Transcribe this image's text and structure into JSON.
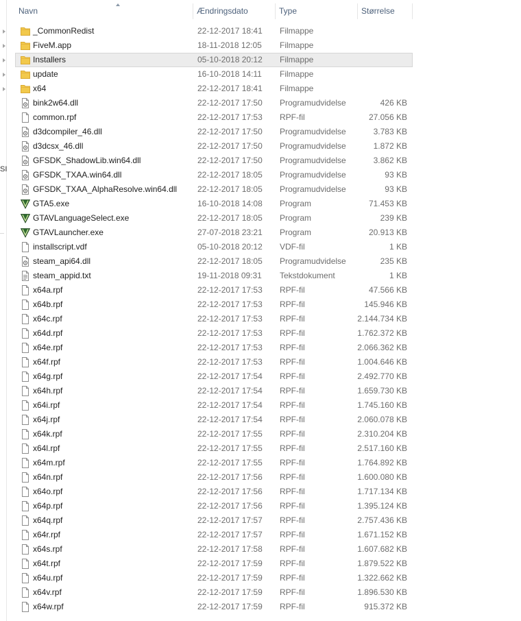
{
  "columns": {
    "name": "Navn",
    "date": "Ændringsdato",
    "type": "Type",
    "size": "Størrelse"
  },
  "left_pane": {
    "partial_text": "SI"
  },
  "colors": {
    "header_text": "#4c607a",
    "folder": "#f2c94c",
    "selected_row": "#ececec"
  },
  "files": [
    {
      "name": "_CommonRedist",
      "date": "22-12-2017 18:41",
      "type": "Filmappe",
      "size": "",
      "icon": "folder-icon",
      "selected": false
    },
    {
      "name": "FiveM.app",
      "date": "18-11-2018 12:05",
      "type": "Filmappe",
      "size": "",
      "icon": "folder-icon",
      "selected": false
    },
    {
      "name": "Installers",
      "date": "05-10-2018 20:12",
      "type": "Filmappe",
      "size": "",
      "icon": "folder-icon",
      "selected": true
    },
    {
      "name": "update",
      "date": "16-10-2018 14:11",
      "type": "Filmappe",
      "size": "",
      "icon": "folder-icon",
      "selected": false
    },
    {
      "name": "x64",
      "date": "22-12-2017 18:41",
      "type": "Filmappe",
      "size": "",
      "icon": "folder-icon",
      "selected": false
    },
    {
      "name": "bink2w64.dll",
      "date": "22-12-2017 17:50",
      "type": "Programudvidelse",
      "size": "426 KB",
      "icon": "dll-icon",
      "selected": false
    },
    {
      "name": "common.rpf",
      "date": "22-12-2017 17:53",
      "type": "RPF-fil",
      "size": "27.056 KB",
      "icon": "file-icon",
      "selected": false
    },
    {
      "name": "d3dcompiler_46.dll",
      "date": "22-12-2017 17:50",
      "type": "Programudvidelse",
      "size": "3.783 KB",
      "icon": "dll-icon",
      "selected": false
    },
    {
      "name": "d3dcsx_46.dll",
      "date": "22-12-2017 17:50",
      "type": "Programudvidelse",
      "size": "1.872 KB",
      "icon": "dll-icon",
      "selected": false
    },
    {
      "name": "GFSDK_ShadowLib.win64.dll",
      "date": "22-12-2017 17:50",
      "type": "Programudvidelse",
      "size": "3.862 KB",
      "icon": "dll-icon",
      "selected": false
    },
    {
      "name": "GFSDK_TXAA.win64.dll",
      "date": "22-12-2017 18:05",
      "type": "Programudvidelse",
      "size": "93 KB",
      "icon": "dll-icon",
      "selected": false
    },
    {
      "name": "GFSDK_TXAA_AlphaResolve.win64.dll",
      "date": "22-12-2017 18:05",
      "type": "Programudvidelse",
      "size": "93 KB",
      "icon": "dll-icon",
      "selected": false
    },
    {
      "name": "GTA5.exe",
      "date": "16-10-2018 14:08",
      "type": "Program",
      "size": "71.453 KB",
      "icon": "gta-v-icon",
      "selected": false
    },
    {
      "name": "GTAVLanguageSelect.exe",
      "date": "22-12-2017 18:05",
      "type": "Program",
      "size": "239 KB",
      "icon": "gta-v-icon",
      "selected": false
    },
    {
      "name": "GTAVLauncher.exe",
      "date": "27-07-2018 23:21",
      "type": "Program",
      "size": "20.913 KB",
      "icon": "gta-v-icon",
      "selected": false
    },
    {
      "name": "installscript.vdf",
      "date": "05-10-2018 20:12",
      "type": "VDF-fil",
      "size": "1 KB",
      "icon": "file-icon",
      "selected": false
    },
    {
      "name": "steam_api64.dll",
      "date": "22-12-2017 18:05",
      "type": "Programudvidelse",
      "size": "235 KB",
      "icon": "dll-icon",
      "selected": false
    },
    {
      "name": "steam_appid.txt",
      "date": "19-11-2018 09:31",
      "type": "Tekstdokument",
      "size": "1 KB",
      "icon": "text-file-icon",
      "selected": false
    },
    {
      "name": "x64a.rpf",
      "date": "22-12-2017 17:53",
      "type": "RPF-fil",
      "size": "47.566 KB",
      "icon": "file-icon",
      "selected": false
    },
    {
      "name": "x64b.rpf",
      "date": "22-12-2017 17:53",
      "type": "RPF-fil",
      "size": "145.946 KB",
      "icon": "file-icon",
      "selected": false
    },
    {
      "name": "x64c.rpf",
      "date": "22-12-2017 17:53",
      "type": "RPF-fil",
      "size": "2.144.734 KB",
      "icon": "file-icon",
      "selected": false
    },
    {
      "name": "x64d.rpf",
      "date": "22-12-2017 17:53",
      "type": "RPF-fil",
      "size": "1.762.372 KB",
      "icon": "file-icon",
      "selected": false
    },
    {
      "name": "x64e.rpf",
      "date": "22-12-2017 17:53",
      "type": "RPF-fil",
      "size": "2.066.362 KB",
      "icon": "file-icon",
      "selected": false
    },
    {
      "name": "x64f.rpf",
      "date": "22-12-2017 17:53",
      "type": "RPF-fil",
      "size": "1.004.646 KB",
      "icon": "file-icon",
      "selected": false
    },
    {
      "name": "x64g.rpf",
      "date": "22-12-2017 17:54",
      "type": "RPF-fil",
      "size": "2.492.770 KB",
      "icon": "file-icon",
      "selected": false
    },
    {
      "name": "x64h.rpf",
      "date": "22-12-2017 17:54",
      "type": "RPF-fil",
      "size": "1.659.730 KB",
      "icon": "file-icon",
      "selected": false
    },
    {
      "name": "x64i.rpf",
      "date": "22-12-2017 17:54",
      "type": "RPF-fil",
      "size": "1.745.160 KB",
      "icon": "file-icon",
      "selected": false
    },
    {
      "name": "x64j.rpf",
      "date": "22-12-2017 17:54",
      "type": "RPF-fil",
      "size": "2.060.078 KB",
      "icon": "file-icon",
      "selected": false
    },
    {
      "name": "x64k.rpf",
      "date": "22-12-2017 17:55",
      "type": "RPF-fil",
      "size": "2.310.204 KB",
      "icon": "file-icon",
      "selected": false
    },
    {
      "name": "x64l.rpf",
      "date": "22-12-2017 17:55",
      "type": "RPF-fil",
      "size": "2.517.160 KB",
      "icon": "file-icon",
      "selected": false
    },
    {
      "name": "x64m.rpf",
      "date": "22-12-2017 17:55",
      "type": "RPF-fil",
      "size": "1.764.892 KB",
      "icon": "file-icon",
      "selected": false
    },
    {
      "name": "x64n.rpf",
      "date": "22-12-2017 17:56",
      "type": "RPF-fil",
      "size": "1.600.080 KB",
      "icon": "file-icon",
      "selected": false
    },
    {
      "name": "x64o.rpf",
      "date": "22-12-2017 17:56",
      "type": "RPF-fil",
      "size": "1.717.134 KB",
      "icon": "file-icon",
      "selected": false
    },
    {
      "name": "x64p.rpf",
      "date": "22-12-2017 17:56",
      "type": "RPF-fil",
      "size": "1.395.124 KB",
      "icon": "file-icon",
      "selected": false
    },
    {
      "name": "x64q.rpf",
      "date": "22-12-2017 17:57",
      "type": "RPF-fil",
      "size": "2.757.436 KB",
      "icon": "file-icon",
      "selected": false
    },
    {
      "name": "x64r.rpf",
      "date": "22-12-2017 17:57",
      "type": "RPF-fil",
      "size": "1.671.152 KB",
      "icon": "file-icon",
      "selected": false
    },
    {
      "name": "x64s.rpf",
      "date": "22-12-2017 17:58",
      "type": "RPF-fil",
      "size": "1.607.682 KB",
      "icon": "file-icon",
      "selected": false
    },
    {
      "name": "x64t.rpf",
      "date": "22-12-2017 17:59",
      "type": "RPF-fil",
      "size": "1.879.522 KB",
      "icon": "file-icon",
      "selected": false
    },
    {
      "name": "x64u.rpf",
      "date": "22-12-2017 17:59",
      "type": "RPF-fil",
      "size": "1.322.662 KB",
      "icon": "file-icon",
      "selected": false
    },
    {
      "name": "x64v.rpf",
      "date": "22-12-2017 17:59",
      "type": "RPF-fil",
      "size": "1.896.530 KB",
      "icon": "file-icon",
      "selected": false
    },
    {
      "name": "x64w.rpf",
      "date": "22-12-2017 17:59",
      "type": "RPF-fil",
      "size": "915.372 KB",
      "icon": "file-icon",
      "selected": false
    }
  ]
}
